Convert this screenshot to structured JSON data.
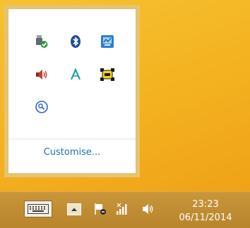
{
  "flyout": {
    "customise_label": "Customise...",
    "icons": [
      {
        "name": "usb-safely-remove-icon"
      },
      {
        "name": "bluetooth-icon"
      },
      {
        "name": "hardware-monitor-icon"
      },
      {
        "name": "speaker-muted-icon"
      },
      {
        "name": "font-accent-icon"
      },
      {
        "name": "yellow-tag-icon"
      },
      {
        "name": "magnifier-icon"
      }
    ]
  },
  "taskbar": {
    "time": "23:23",
    "date": "06/11/2014",
    "icons": [
      "touch-keyboard-icon",
      "show-hidden-icons-chevron-icon",
      "action-center-flag-icon",
      "network-signal-icon",
      "volume-icon"
    ]
  },
  "colors": {
    "desktop": "#f4b321",
    "taskbar": "#c0903a",
    "link": "#1e6fb3"
  }
}
